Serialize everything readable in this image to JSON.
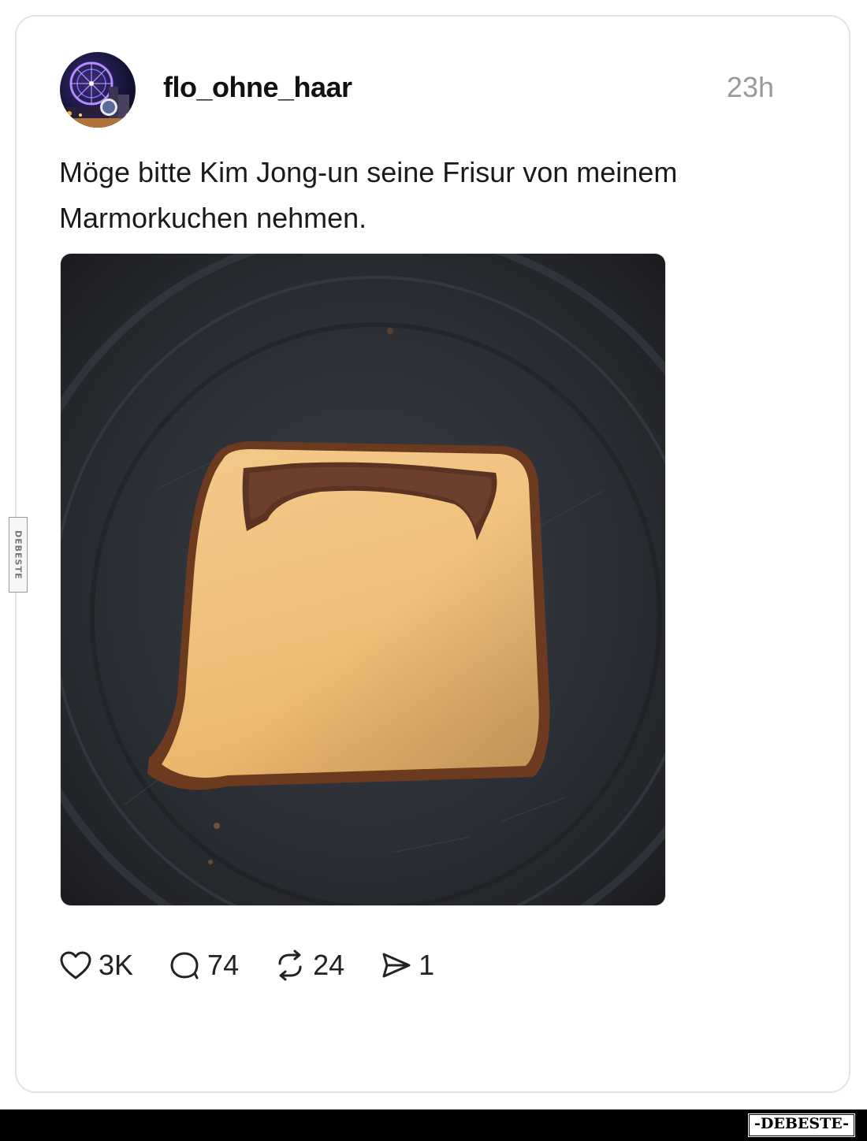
{
  "post": {
    "username": "flo_ohne_haar",
    "time": "23h",
    "text_line1": "Möge bitte Kim Jong-un seine Frisur von meinem",
    "text_line2": "Marmorkuchen nehmen."
  },
  "actions": {
    "likes": "3K",
    "comments": "74",
    "reposts": "24",
    "shares": "1",
    "icons": [
      "heart-icon",
      "comment-icon",
      "repost-icon",
      "send-icon"
    ]
  },
  "watermark": {
    "side": "DEBESTE",
    "bottom": "-DEBESTE-"
  },
  "colors": {
    "text": "#111111",
    "muted": "#9a9a9a",
    "card_border": "#e3e3e3"
  }
}
